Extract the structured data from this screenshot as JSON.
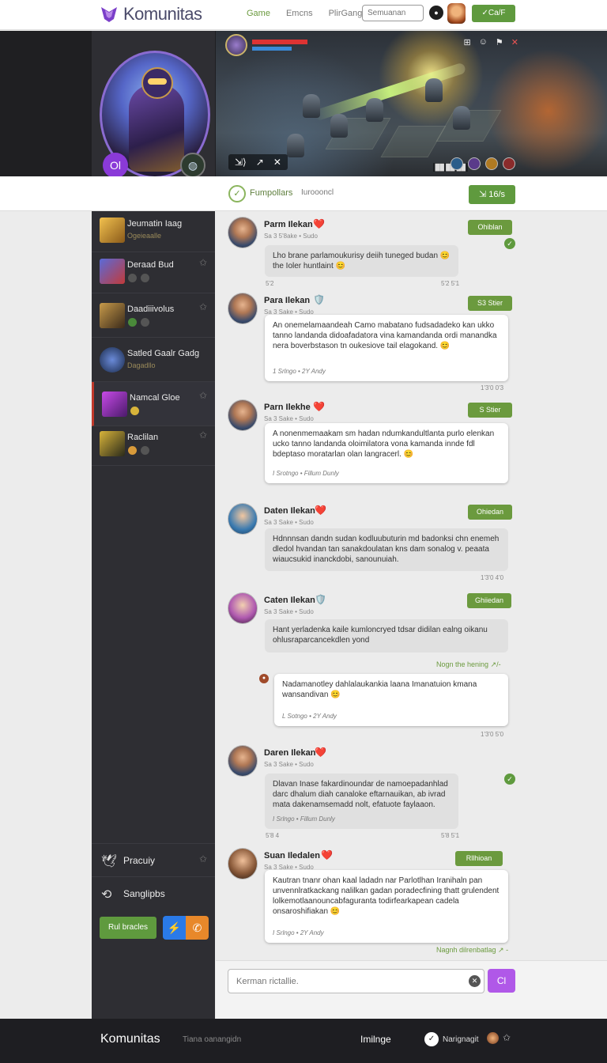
{
  "topnav": {
    "brand": "Komunitas",
    "links": [
      "Game",
      "Emcns",
      "PlirGang"
    ],
    "search_placeholder": "Semuanan",
    "cta_label": "✓Ca/F"
  },
  "hero": {
    "badge_label": "Ol",
    "hud_bottom_left": [
      "⇲⟩",
      "↗",
      "✕"
    ],
    "hud_status": "██  ██ ██"
  },
  "sidebar": {
    "items": [
      {
        "title": "Jeumatin Iaag",
        "sub": "Ogeieaalle"
      },
      {
        "title": "Deraad Bud",
        "sub": ""
      },
      {
        "title": "Daadiiivolus",
        "sub": ""
      },
      {
        "title": "Satled Gaalr Gadg",
        "sub": "Dagadllo"
      },
      {
        "title": "Namcal Gloe",
        "sub": ""
      },
      {
        "title": "Raclilan",
        "sub": ""
      }
    ],
    "links": [
      {
        "icon": "🕊",
        "label": "Pracuiy"
      },
      {
        "icon": "⟲",
        "label": "Sanglipbs"
      }
    ],
    "btn_label": "Rul bracles"
  },
  "tabs": {
    "active": "Fumpollars",
    "inactive": "Iuroooncl",
    "cta": "⇲ 16/s"
  },
  "posts": [
    {
      "name": "Parm Ilekan",
      "emoji": "❤️",
      "meta": "Sa  3 5'8ake  •  Sudo",
      "badge": "Ohiblan",
      "text": "Lho brane parlamoukurisy deiih tuneged budan 😊 the Ioler huntlaint 😊",
      "foot": "",
      "side_left": "5'2",
      "side_right": "5'2 5'1"
    },
    {
      "name": "Para Ilekan",
      "emoji": "🛡️",
      "meta": "Sa  3 Sake  •  Sudo",
      "badge": "S3 Stier",
      "text": "An onemelamaandeah Camo mabatano fudsadadeko kan ukko tanno landanda didoafadatora vina kamandanda ordi manandka nera boverbstason tn oukesiove tail elagokand. 😊",
      "foot": "1 Srlngo  •  2Y Andy",
      "side": "1'3'0  0'3"
    },
    {
      "name": "Parn Ilekhe",
      "emoji": "❤️",
      "meta": "Sa  3 Sake  •  Sudo",
      "badge": "S Stier",
      "text": "A nonenmemaakam sm hadan ndumkandultlanta purlo elenkan ucko tanno landanda oloimilatora vona kamanda innde fdl bdeptaso moratarlan olan langracerl. 😊",
      "foot": "I  Srotngo  •  Fillum Dunly",
      "side": ""
    },
    {
      "name": "Daten Ilekan",
      "emoji": "❤️",
      "meta": "Sa  3 Sake  •  Sudo",
      "badge": "Ohiedan",
      "text": "Hdnnnsan dandn sudan kodluubuturin md badonksi chn enemeh dledol hvandan tan sanakdoulatan kns dam sonalog v. peaata wiaucsukid inanckdobi, sanounuiah.",
      "foot": "",
      "side": "1'3'0  4'0"
    },
    {
      "name": "Caten Ilekan",
      "emoji": "🛡️",
      "meta": "Sa  3 Sake  •  Sudo",
      "badge": "Ghiiedan",
      "text": "Hant yerladenka kaile kumloncryed tdsar didilan ealng oikanu ohlusraparcancekdlen yond",
      "foot": "",
      "side": "Nogn the hening ↗/-"
    },
    {
      "name": "",
      "emoji": "",
      "meta": "",
      "badge": "",
      "text": "Nadamanotley dahlalaukankia laana Imanatuion kmana wansandivan 😊",
      "foot": "L  Sotngo  •  2Y Andy",
      "side": "1'3'0  5'0"
    },
    {
      "name": "Daren Ilekan",
      "emoji": "❤️",
      "meta": "Sa  3 Sake  •  Sudo",
      "badge": "",
      "text": "Dlavan Inase fakardinoundar de namoepadanhlad darc dhalum diah canaloke eftarnauikan, ab ivrad mata dakenamsemadd nolt, efatuote faylaaon.",
      "foot": "I  Srlngo  •  Fillum Dunly",
      "side_left": "5'8  4",
      "side_right": "5'8 5'1"
    },
    {
      "name": "Suan Iledalen",
      "emoji": "❤️",
      "meta": "Sa  3 Sake  •  Sudo",
      "badge": "Rllhioan",
      "text": "Kautran tnanr ohan kaal ladadn nar Parlotlhan Iranihaln pan unvennlratkackang nalilkan gadan poradecfining thatt grulendent lolkemotlaanouncabfaguranta todirfearkapean cadela onsaroshifiakan 😊",
      "foot": "I  Srlngo  •  2Y Andy",
      "side": "Nagnh dilrenbatlag ↗ -"
    }
  ],
  "composer": {
    "placeholder": "Kerman rictallie.",
    "send_label": "Cl"
  },
  "footer": {
    "brand": "Komunitas",
    "tagline": "Tiana oanangidn",
    "lang": "Imilnge",
    "nav": "Narignagit"
  },
  "colors": {
    "accent_green": "#5f9a3e",
    "accent_purple": "#b058e8",
    "sidebar_dark": "#2e2e33",
    "footer_dark": "#1e1e22"
  }
}
